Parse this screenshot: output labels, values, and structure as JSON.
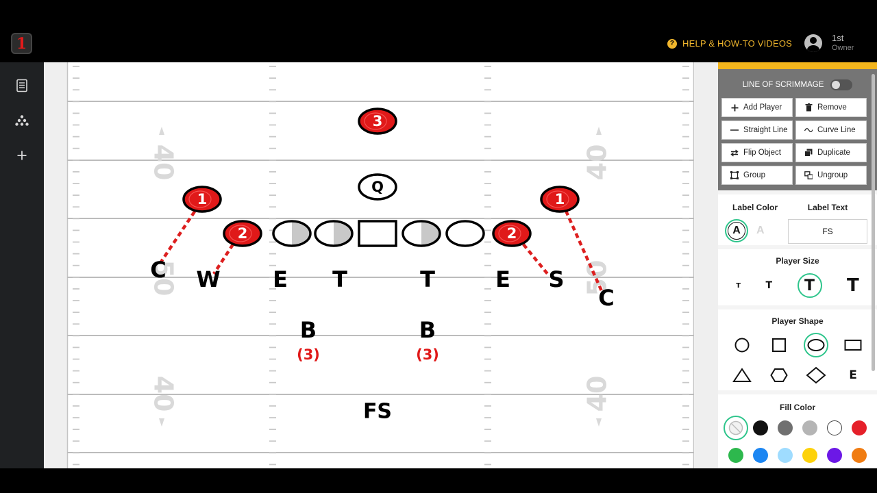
{
  "header": {
    "logo_text": "1",
    "help_label": "HELP & HOW-TO VIDEOS",
    "user_name": "1st",
    "user_role": "Owner"
  },
  "sidebar": {
    "items": [
      {
        "icon": "playbook-icon"
      },
      {
        "icon": "formation-icon"
      },
      {
        "icon": "add-icon"
      }
    ]
  },
  "field": {
    "yard_numbers": [
      "40",
      "50",
      "40"
    ],
    "players": [
      {
        "label": "3",
        "style": "red-oval"
      },
      {
        "label": "Q",
        "style": "white-oval"
      },
      {
        "label": "1",
        "style": "red-oval"
      },
      {
        "label": "1",
        "style": "red-oval"
      },
      {
        "label": "2",
        "style": "red-oval"
      },
      {
        "label": "2",
        "style": "red-oval"
      },
      {
        "label": "",
        "style": "half-gray-oval"
      },
      {
        "label": "",
        "style": "half-gray-oval"
      },
      {
        "label": "",
        "style": "rectangle"
      },
      {
        "label": "",
        "style": "half-gray-oval"
      },
      {
        "label": "",
        "style": "white-oval"
      },
      {
        "label": "C",
        "style": "text"
      },
      {
        "label": "W",
        "style": "text"
      },
      {
        "label": "E",
        "style": "text"
      },
      {
        "label": "T",
        "style": "text"
      },
      {
        "label": "T",
        "style": "text"
      },
      {
        "label": "E",
        "style": "text"
      },
      {
        "label": "S",
        "style": "text"
      },
      {
        "label": "C",
        "style": "text"
      },
      {
        "label": "B",
        "style": "text"
      },
      {
        "label": "B",
        "style": "text"
      },
      {
        "label": "FS",
        "style": "text"
      }
    ],
    "gap_labels": [
      "(3)",
      "(3)"
    ],
    "colors": {
      "red": "#e01919",
      "line_red": "#dd1f1f",
      "gray_fill": "#c8c8c8",
      "field_line": "#bcbcbc"
    }
  },
  "panel": {
    "line_of_scrimmage_label": "LINE OF SCRIMMAGE",
    "line_of_scrimmage_on": false,
    "buttons": [
      {
        "label": "Add Player",
        "icon": "plus-icon"
      },
      {
        "label": "Remove",
        "icon": "trash-icon"
      },
      {
        "label": "Straight Line",
        "icon": "straight-line-icon"
      },
      {
        "label": "Curve Line",
        "icon": "curve-line-icon"
      },
      {
        "label": "Flip Object",
        "icon": "flip-icon"
      },
      {
        "label": "Duplicate",
        "icon": "duplicate-icon"
      },
      {
        "label": "Group",
        "icon": "group-icon"
      },
      {
        "label": "Ungroup",
        "icon": "ungroup-icon"
      }
    ],
    "label_color_title": "Label Color",
    "label_color_glyph": "A",
    "label_text_title": "Label Text",
    "label_text_value": "FS",
    "player_size_title": "Player Size",
    "size_glyph": "T",
    "player_shape_title": "Player Shape",
    "shape_text_glyph": "E",
    "fill_color_title": "Fill Color",
    "fill_colors": [
      "none",
      "#111111",
      "#707070",
      "#b5b5b5",
      "#ffffff",
      "#e5202a",
      "#2db84d",
      "#1c86f2",
      "#9fdcff",
      "#fdd20b",
      "#6c18e6",
      "#f07c12"
    ],
    "accent_color": "#f3b51d",
    "selected_ring_color": "#2fc58c"
  }
}
